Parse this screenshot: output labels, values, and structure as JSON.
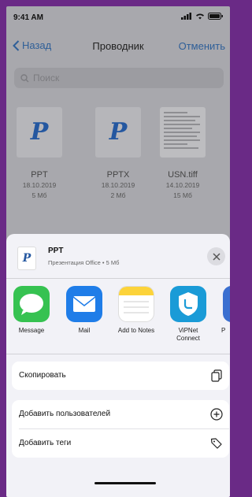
{
  "status": {
    "time": "9:41 AM"
  },
  "nav": {
    "back_label": "Назад",
    "title": "Проводник",
    "cancel_label": "Отменить"
  },
  "search": {
    "placeholder": "Поиск"
  },
  "files": [
    {
      "name": "PPT",
      "date": "18.10.2019",
      "size": "5 Мб",
      "icon": "powerpoint-icon"
    },
    {
      "name": "PPTX",
      "date": "18.10.2019",
      "size": "2 Мб",
      "icon": "powerpoint-icon"
    },
    {
      "name": "USN.tiff",
      "date": "14.10.2019",
      "size": "15 Мб",
      "icon": "document-thumbnail"
    }
  ],
  "share_sheet": {
    "file_name": "PPT",
    "file_info": "Презентация Office • 5 Мб",
    "apps": [
      {
        "label": "Message",
        "icon": "message-app-icon",
        "color": "#36c251"
      },
      {
        "label": "Mail",
        "icon": "mail-app-icon",
        "color": "#1f7de8"
      },
      {
        "label": "Add to Notes",
        "icon": "notes-app-icon",
        "color": "#fcd33a"
      },
      {
        "label": "ViPNet Connect",
        "icon": "vipnet-app-icon",
        "color": "#1a9bd7"
      },
      {
        "label": "P",
        "icon": "partial-app-icon",
        "color": "#3b6fd0"
      }
    ],
    "actions_primary": [
      {
        "label": "Скопировать",
        "icon": "copy-icon"
      }
    ],
    "actions_secondary": [
      {
        "label": "Добавить пользователей",
        "icon": "add-circle-icon"
      },
      {
        "label": "Добавить теги",
        "icon": "tag-icon"
      }
    ]
  },
  "colors": {
    "accent": "#2f5f98",
    "frame": "#6a2a86"
  }
}
